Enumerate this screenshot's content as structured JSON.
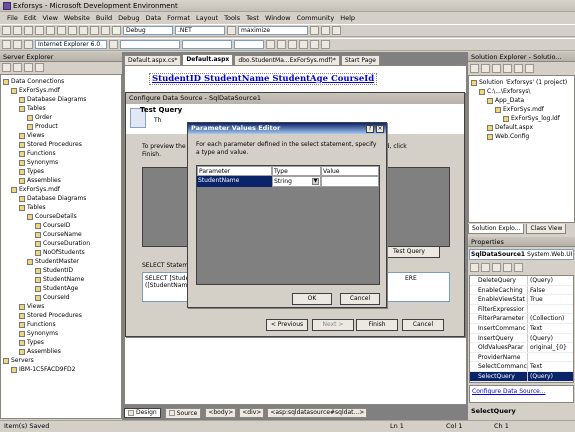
{
  "window": {
    "title": "Exforsys - Microsoft Development Environment"
  },
  "menu": [
    "File",
    "Edit",
    "View",
    "Website",
    "Build",
    "Debug",
    "Data",
    "Format",
    "Layout",
    "Tools",
    "Test",
    "Window",
    "Community",
    "Help"
  ],
  "toolbar": {
    "config": "Debug",
    "platform": ".NET",
    "search": "maximize",
    "browser": "Internet Explorer 6.0"
  },
  "server_explorer": {
    "title": "Server Explorer",
    "items": [
      {
        "label": "Data Connections",
        "indent": 0
      },
      {
        "label": "ExForSys.mdf",
        "indent": 1
      },
      {
        "label": "Database Diagrams",
        "indent": 2
      },
      {
        "label": "Tables",
        "indent": 2
      },
      {
        "label": "Order",
        "indent": 3
      },
      {
        "label": "Product",
        "indent": 3
      },
      {
        "label": "Views",
        "indent": 2
      },
      {
        "label": "Stored Procedures",
        "indent": 2
      },
      {
        "label": "Functions",
        "indent": 2
      },
      {
        "label": "Synonyms",
        "indent": 2
      },
      {
        "label": "Types",
        "indent": 2
      },
      {
        "label": "Assemblies",
        "indent": 2
      },
      {
        "label": "ExForSys.mdf",
        "indent": 1
      },
      {
        "label": "Database Diagrams",
        "indent": 2
      },
      {
        "label": "Tables",
        "indent": 2
      },
      {
        "label": "CourseDetails",
        "indent": 3
      },
      {
        "label": "CourseID",
        "indent": 4
      },
      {
        "label": "CourseName",
        "indent": 4
      },
      {
        "label": "CourseDuration",
        "indent": 4
      },
      {
        "label": "NoOfStudents",
        "indent": 4
      },
      {
        "label": "StudentMaster",
        "indent": 3
      },
      {
        "label": "StudentID",
        "indent": 4
      },
      {
        "label": "StudentName",
        "indent": 4
      },
      {
        "label": "StudentAge",
        "indent": 4
      },
      {
        "label": "CourseId",
        "indent": 4
      },
      {
        "label": "Views",
        "indent": 2
      },
      {
        "label": "Stored Procedures",
        "indent": 2
      },
      {
        "label": "Functions",
        "indent": 2
      },
      {
        "label": "Synonyms",
        "indent": 2
      },
      {
        "label": "Types",
        "indent": 2
      },
      {
        "label": "Assemblies",
        "indent": 2
      },
      {
        "label": "Servers",
        "indent": 0
      },
      {
        "label": "IBM-1C5FACD9FD2",
        "indent": 1
      }
    ]
  },
  "tabs": [
    "Default.aspx.cs*",
    "Default.aspx",
    "dbo.StudentMa...ExForSys.mdf)*",
    "Start Page"
  ],
  "editor": {
    "header_text": "StudentID StudentName StudentAge CourseId"
  },
  "configure_ds": {
    "title": "Configure Data Source - SqlDataSource1",
    "heading": "Test Query",
    "subtext": "Th",
    "preview_text": "To preview the",
    "preview_text2": "Finish.",
    "preview_right": "ed, click",
    "test_query_button": "Test Query",
    "select_label": "SELECT Stateme",
    "select_text": "SELECT [Studen",
    "select_text2": "([StudentName]",
    "select_right": "ERE",
    "prev_button": "< Previous",
    "next_button": "Next >",
    "finish_button": "Finish",
    "cancel_button": "Cancel"
  },
  "param_editor": {
    "title": "Parameter Values Editor",
    "instructions": "For each parameter defined in the select statement, specify a type and value.",
    "columns": [
      "Parameter",
      "Type",
      "Value"
    ],
    "row": {
      "parameter": "StudentName",
      "type": "String",
      "value": ""
    },
    "ok_button": "OK",
    "cancel_button": "Cancel"
  },
  "bottom_tabs": {
    "design": "Design",
    "source": "Source"
  },
  "breadcrumb": [
    "<body>",
    "<div>",
    "<asp:sqldatasource#sqldat...>"
  ],
  "solution_explorer": {
    "title": "Solution Explorer - Solutio...",
    "items": [
      {
        "label": "Solution 'Exforsys' (1 project)",
        "indent": 0
      },
      {
        "label": "C:\\...\\Exforsys\\",
        "indent": 1
      },
      {
        "label": "App_Data",
        "indent": 2
      },
      {
        "label": "ExForSys.mdf",
        "indent": 3
      },
      {
        "label": "ExForSys_log.ldf",
        "indent": 4
      },
      {
        "label": "Default.aspx",
        "indent": 2
      },
      {
        "label": "Web.Config",
        "indent": 2
      }
    ],
    "tabs": [
      "Solution Explo...",
      "Class View"
    ]
  },
  "properties": {
    "title": "Properties",
    "object": "SqlDataSource1",
    "object_type": "System.Web.UI",
    "rows": [
      {
        "name": "DeleteQuery",
        "value": "(Query)"
      },
      {
        "name": "EnableCaching",
        "value": "False"
      },
      {
        "name": "EnableViewStat",
        "value": "True"
      },
      {
        "name": "FilterExpressior",
        "value": ""
      },
      {
        "name": "FilterParameter",
        "value": "(Collection)"
      },
      {
        "name": "InsertCommanc",
        "value": "Text"
      },
      {
        "name": "InsertQuery",
        "value": "(Query)"
      },
      {
        "name": "OldValuesParar",
        "value": "original_{0}"
      },
      {
        "name": "ProviderName",
        "value": ""
      },
      {
        "name": "SelectCommanc",
        "value": "Text"
      },
      {
        "name": "SelectQuery",
        "value": "(Query)"
      }
    ],
    "link": "Configure Data Source...",
    "selected": "SelectQuery"
  },
  "status": {
    "text": "Item(s) Saved",
    "ln": "Ln 1",
    "col": "Col 1",
    "ch": "Ch 1"
  }
}
